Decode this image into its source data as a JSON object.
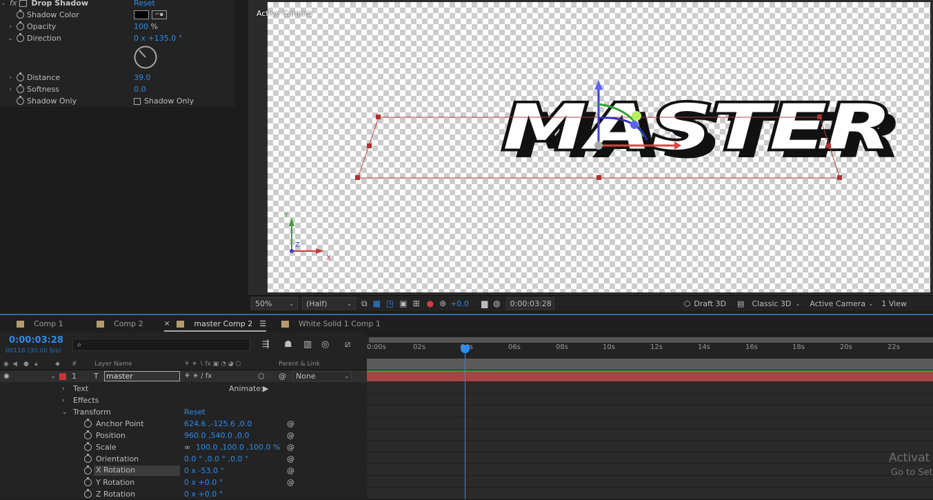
{
  "effects": {
    "effect_name": "Drop Shadow",
    "reset": "Reset",
    "props": [
      {
        "label": "Shadow Color",
        "value": ""
      },
      {
        "label": "Opacity",
        "value": "100",
        "unit": "%"
      },
      {
        "label": "Direction",
        "value": "0 x +135.0 °"
      },
      {
        "label": "Distance",
        "value": "39.0"
      },
      {
        "label": "Softness",
        "value": "0.0"
      },
      {
        "label": "Shadow Only",
        "value": "Shadow Only"
      }
    ]
  },
  "viewer": {
    "camera_label": "Active Camera",
    "text": "MASTER",
    "axis": {
      "x": "X",
      "y": "Y",
      "z": "Z"
    }
  },
  "viewer_toolbar": {
    "zoom": "50%",
    "resolution": "(Half)",
    "exposure": "+0.0",
    "timecode": "0:00:03:28",
    "renderer": "Draft 3D",
    "renderer_mode": "Classic 3D",
    "camera": "Active Camera",
    "views": "1 View"
  },
  "tabs": [
    {
      "label": "Comp 1"
    },
    {
      "label": "Comp 2"
    },
    {
      "label": "master Comp 2"
    },
    {
      "label": "White Solid 1 Comp 1"
    }
  ],
  "timeline": {
    "timecode": "0:00:03:28",
    "frame_info": "00118 (30.00 fps)",
    "search_placeholder": "",
    "col_num": "#",
    "col_layer": "Layer Name",
    "col_parent": "Parent & Link",
    "layer_num": "1",
    "layer_name": "master",
    "parent": "None",
    "animate": "Animate:",
    "groups": [
      "Text",
      "Effects",
      "Transform"
    ],
    "transform_reset": "Reset",
    "props": [
      {
        "label": "Anchor Point",
        "value": "624.6 ,-125.6 ,0.0"
      },
      {
        "label": "Position",
        "value": "960.0 ,540.0 ,0.0"
      },
      {
        "label": "Scale",
        "value": "100.0 ,100.0 ,100.0 %"
      },
      {
        "label": "Orientation",
        "value": "0.0 ° ,0.0 ° ,0.0 °"
      },
      {
        "label": "X Rotation",
        "value": "0 x -53.0 °"
      },
      {
        "label": "Y Rotation",
        "value": "0 x +0.0 °"
      },
      {
        "label": "Z Rotation",
        "value": "0 x +0.0 °"
      }
    ],
    "ticks": [
      "0:00s",
      "02s",
      "04s",
      "06s",
      "08s",
      "10s",
      "12s",
      "14s",
      "16s",
      "18s",
      "20s",
      "22s"
    ]
  },
  "watermark": {
    "line1": "Activat",
    "line2": "Go to Set"
  },
  "colors": {
    "accent": "#2d8ceb",
    "layer_bar": "#a84444",
    "label_red": "#c33"
  }
}
